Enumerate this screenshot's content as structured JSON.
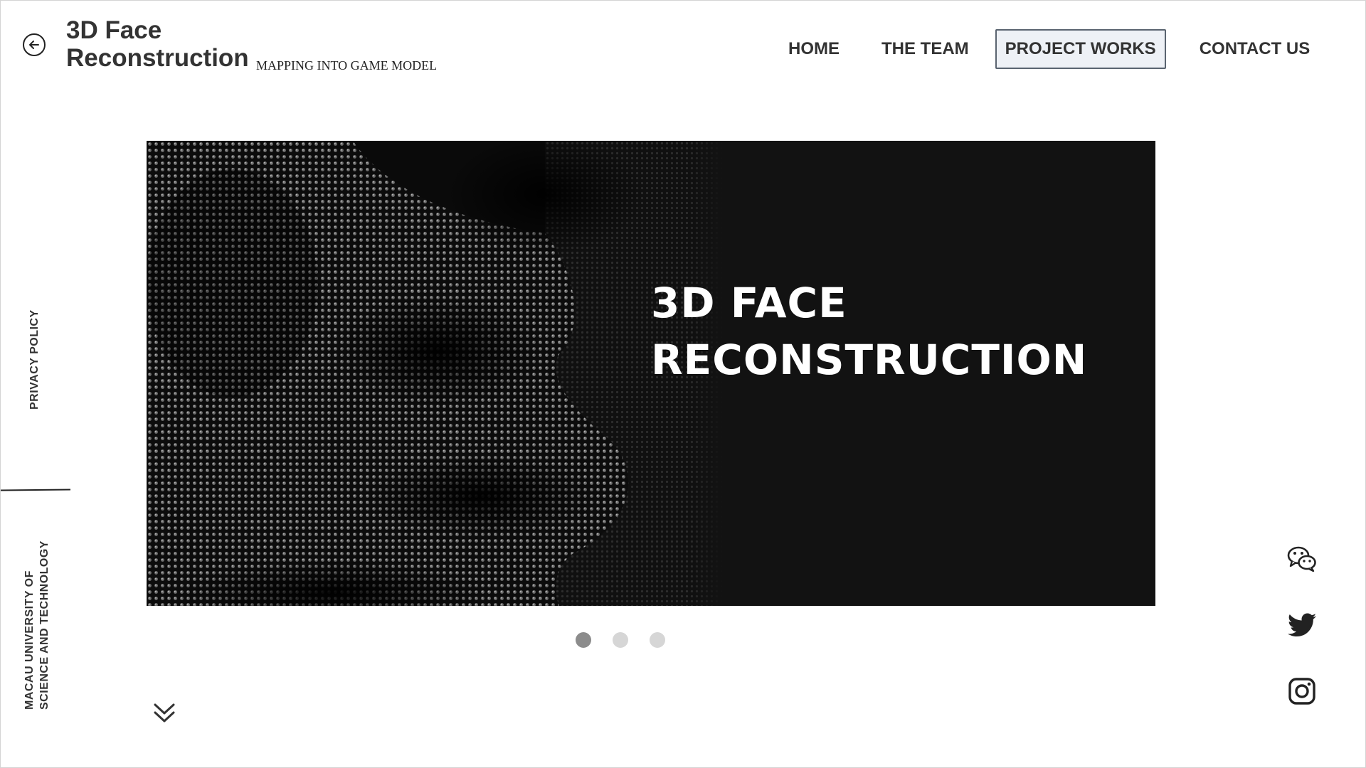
{
  "header": {
    "title_line1": "3D Face",
    "title_line2": "Reconstruction",
    "subtitle": "MAPPING INTO GAME MODEL"
  },
  "nav": {
    "items": [
      {
        "label": "HOME",
        "active": false
      },
      {
        "label": "THE TEAM",
        "active": false
      },
      {
        "label": "PROJECT WORKS",
        "active": true
      },
      {
        "label": "CONTACT US",
        "active": false
      }
    ]
  },
  "hero": {
    "title_line1": "3D FACE",
    "title_line2": "RECONSTRUCTION",
    "slide_count": 3,
    "active_slide": 1
  },
  "sidebar": {
    "privacy_label": "PRIVACY POLICY",
    "university_line1": "MACAU UNIVERSITY OF",
    "university_line2": "SCIENCE AND TECHNOLOGY"
  },
  "social": [
    "wechat-icon",
    "twitter-icon",
    "instagram-icon"
  ],
  "icons": {
    "back": "arrow-left-circle-icon",
    "scroll": "double-chevron-down-icon"
  },
  "colors": {
    "nav_active_bg": "#eef1f6",
    "nav_active_border": "#5a6470",
    "hero_bg": "#121212",
    "dot_active": "#8c8c8c",
    "dot_inactive": "#d6d6d6"
  }
}
